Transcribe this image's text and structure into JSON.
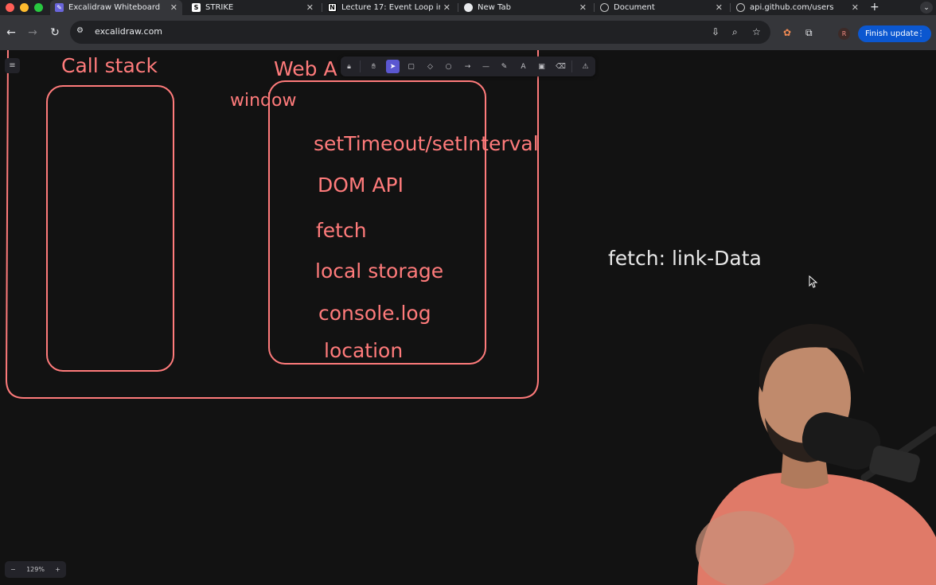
{
  "browser": {
    "tabs": [
      {
        "title": "Excalidraw Whiteboard",
        "active": true,
        "icon": "excalidraw-logo-icon"
      },
      {
        "title": "STRIKE",
        "active": false,
        "icon": "strike-logo-icon"
      },
      {
        "title": "Lecture 17: Event Loop in",
        "active": false,
        "icon": "notion-logo-icon"
      },
      {
        "title": "New Tab",
        "active": false,
        "icon": "chrome-logo-icon"
      },
      {
        "title": "Document",
        "active": false,
        "icon": "globe-icon"
      },
      {
        "title": "api.github.com/users",
        "active": false,
        "icon": "globe-icon"
      }
    ],
    "url": "excalidraw.com",
    "profile_initial": "R",
    "finish_update_label": "Finish update"
  },
  "canvas": {
    "labels": {
      "call_stack": "Call stack",
      "web_apis": "Web A",
      "window": "window",
      "set_timeout": "setTimeout/setInterval",
      "dom_api": "DOM API",
      "fetch": "fetch",
      "local_storage": "local storage",
      "console_log": "console.log",
      "location": "location",
      "fetch_note": "fetch: link-Data"
    },
    "stroke_color": "#ff7b7b",
    "note_color": "#e8e8e8",
    "background": "#121212"
  },
  "excalidraw_toolbar": {
    "tools": [
      "lock-icon",
      "hand-icon",
      "select-icon",
      "rectangle-icon",
      "diamond-icon",
      "ellipse-icon",
      "arrow-icon",
      "line-icon",
      "pencil-icon",
      "text-icon",
      "image-icon",
      "eraser-icon",
      "library-icon"
    ],
    "selected": "select-icon"
  },
  "zoom": {
    "level": "129%",
    "minus": "−",
    "plus": "+"
  }
}
